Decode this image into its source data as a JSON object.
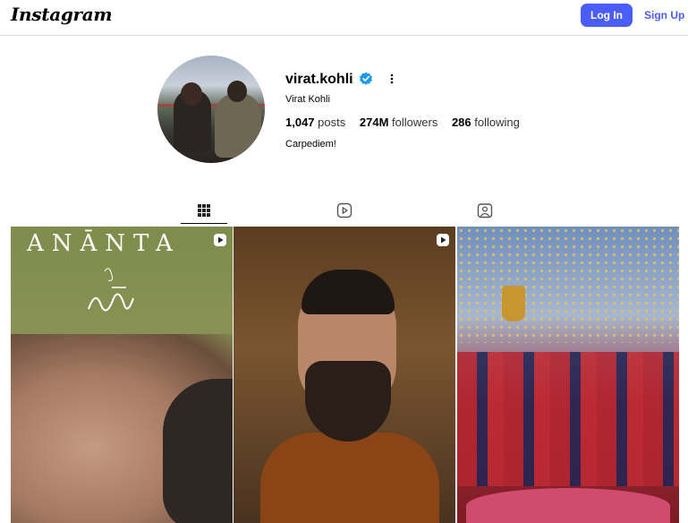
{
  "header": {
    "logo": "Instagram",
    "login_label": "Log In",
    "signup_label": "Sign Up"
  },
  "profile": {
    "username": "virat.kohli",
    "full_name": "Virat Kohli",
    "posts_count": "1,047",
    "posts_label": "posts",
    "followers_count": "274M",
    "followers_label": "followers",
    "following_count": "286",
    "following_label": "following",
    "bio": "Carpediem!",
    "verified": true
  },
  "tabs": [
    {
      "icon": "grid-icon",
      "active": true
    },
    {
      "icon": "reels-icon",
      "active": false
    },
    {
      "icon": "tagged-icon",
      "active": false
    }
  ],
  "posts": [
    {
      "overlay_text": "ANĀNTA",
      "type": "reel"
    },
    {
      "overlay_text": "",
      "type": "reel"
    },
    {
      "overlay_text": "",
      "type": "image"
    }
  ],
  "colors": {
    "accent": "#4a5df9",
    "verified": "#1d9bf0",
    "divider": "#dbdbdb"
  }
}
